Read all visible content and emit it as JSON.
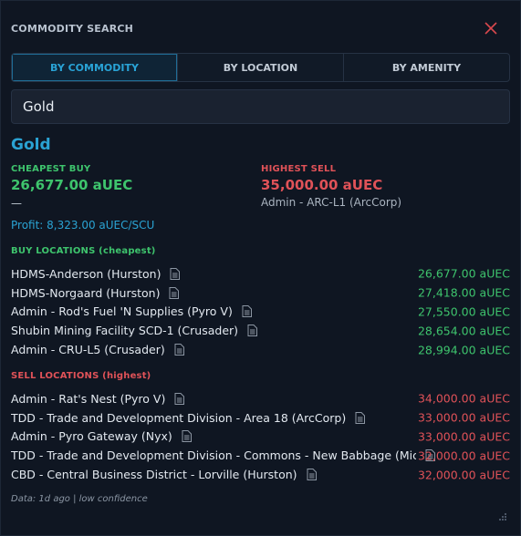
{
  "title": "COMMODITY SEARCH",
  "tabs": [
    {
      "label": "BY COMMODITY",
      "active": true
    },
    {
      "label": "BY LOCATION",
      "active": false
    },
    {
      "label": "BY AMENITY",
      "active": false
    }
  ],
  "search": {
    "value": "Gold"
  },
  "commodity": {
    "name": "Gold",
    "cheapest_buy_label": "CHEAPEST BUY",
    "cheapest_buy_value": "26,677.00 aUEC",
    "cheapest_buy_location": "—",
    "highest_sell_label": "HIGHEST SELL",
    "highest_sell_value": "35,000.00 aUEC",
    "highest_sell_location": "Admin - ARC-L1 (ArcCorp)",
    "profit": "Profit: 8,323.00 aUEC/SCU"
  },
  "buy_section": {
    "label": "BUY LOCATIONS (cheapest)",
    "items": [
      {
        "name": "HDMS-Anderson (Hurston)",
        "price": "26,677.00 aUEC"
      },
      {
        "name": "HDMS-Norgaard (Hurston)",
        "price": "27,418.00 aUEC"
      },
      {
        "name": "Admin - Rod's Fuel 'N Supplies (Pyro V)",
        "price": "27,550.00 aUEC"
      },
      {
        "name": "Shubin Mining Facility SCD-1 (Crusader)",
        "price": "28,654.00 aUEC"
      },
      {
        "name": "Admin - CRU-L5 (Crusader)",
        "price": "28,994.00 aUEC"
      }
    ]
  },
  "sell_section": {
    "label": "SELL LOCATIONS (highest)",
    "items": [
      {
        "name": "Admin - Rat's Nest (Pyro V)",
        "price": "34,000.00 aUEC"
      },
      {
        "name": "TDD - Trade and Development Division - Area 18 (ArcCorp)",
        "price": "33,000.00 aUEC"
      },
      {
        "name": "Admin - Pyro Gateway (Nyx)",
        "price": "33,000.00 aUEC"
      },
      {
        "name": "TDD - Trade and Development Division - Commons - New Babbage (Micr",
        "price": "32,000.00 aUEC"
      },
      {
        "name": "CBD - Central Business District - Lorville (Hurston)",
        "price": "32,000.00 aUEC"
      }
    ]
  },
  "footer": "Data: 1d ago | low confidence",
  "colors": {
    "accent": "#2aa3d3",
    "buy": "#3ec46d",
    "sell": "#e05258"
  },
  "icons": {
    "close": "close-icon",
    "doc": "document-icon",
    "resize": "resize-grip-icon"
  }
}
